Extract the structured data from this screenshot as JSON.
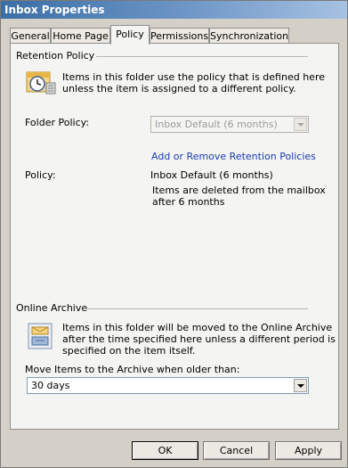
{
  "window": {
    "title": "Inbox Properties"
  },
  "tabs": [
    {
      "label": "General"
    },
    {
      "label": "Home Page"
    },
    {
      "label": "Policy",
      "active": true
    },
    {
      "label": "Permissions"
    },
    {
      "label": "Synchronization"
    }
  ],
  "retention": {
    "group_label": "Retention Policy",
    "description_line1": "Items in this folder use the policy that is defined here",
    "description_line2": "unless the item is assigned to a different policy.",
    "folder_policy_label": "Folder Policy:",
    "folder_policy_value": "Inbox Default (6 months)",
    "link_label": "Add or Remove Retention Policies",
    "policy_label": "Policy:",
    "policy_value": "Inbox Default (6 months)",
    "policy_detail_line1": "Items are deleted from the mailbox",
    "policy_detail_line2": "after 6 months"
  },
  "archive": {
    "group_label": "Online Archive",
    "description_line1": "Items in this folder will be moved to the Online Archive",
    "description_line2": "after the time specified here unless a different period is",
    "description_line3": "specified on the item itself.",
    "move_label": "Move Items to the Archive when older than:",
    "move_value": "30 days"
  },
  "buttons": {
    "ok": "OK",
    "cancel": "Cancel",
    "apply": "Apply"
  },
  "icons": {
    "retention": "calendar-clock-icon",
    "archive": "archive-envelope-icon"
  },
  "colors": {
    "link": "#1a3bb0",
    "titlebar": "#3a6ea5"
  }
}
